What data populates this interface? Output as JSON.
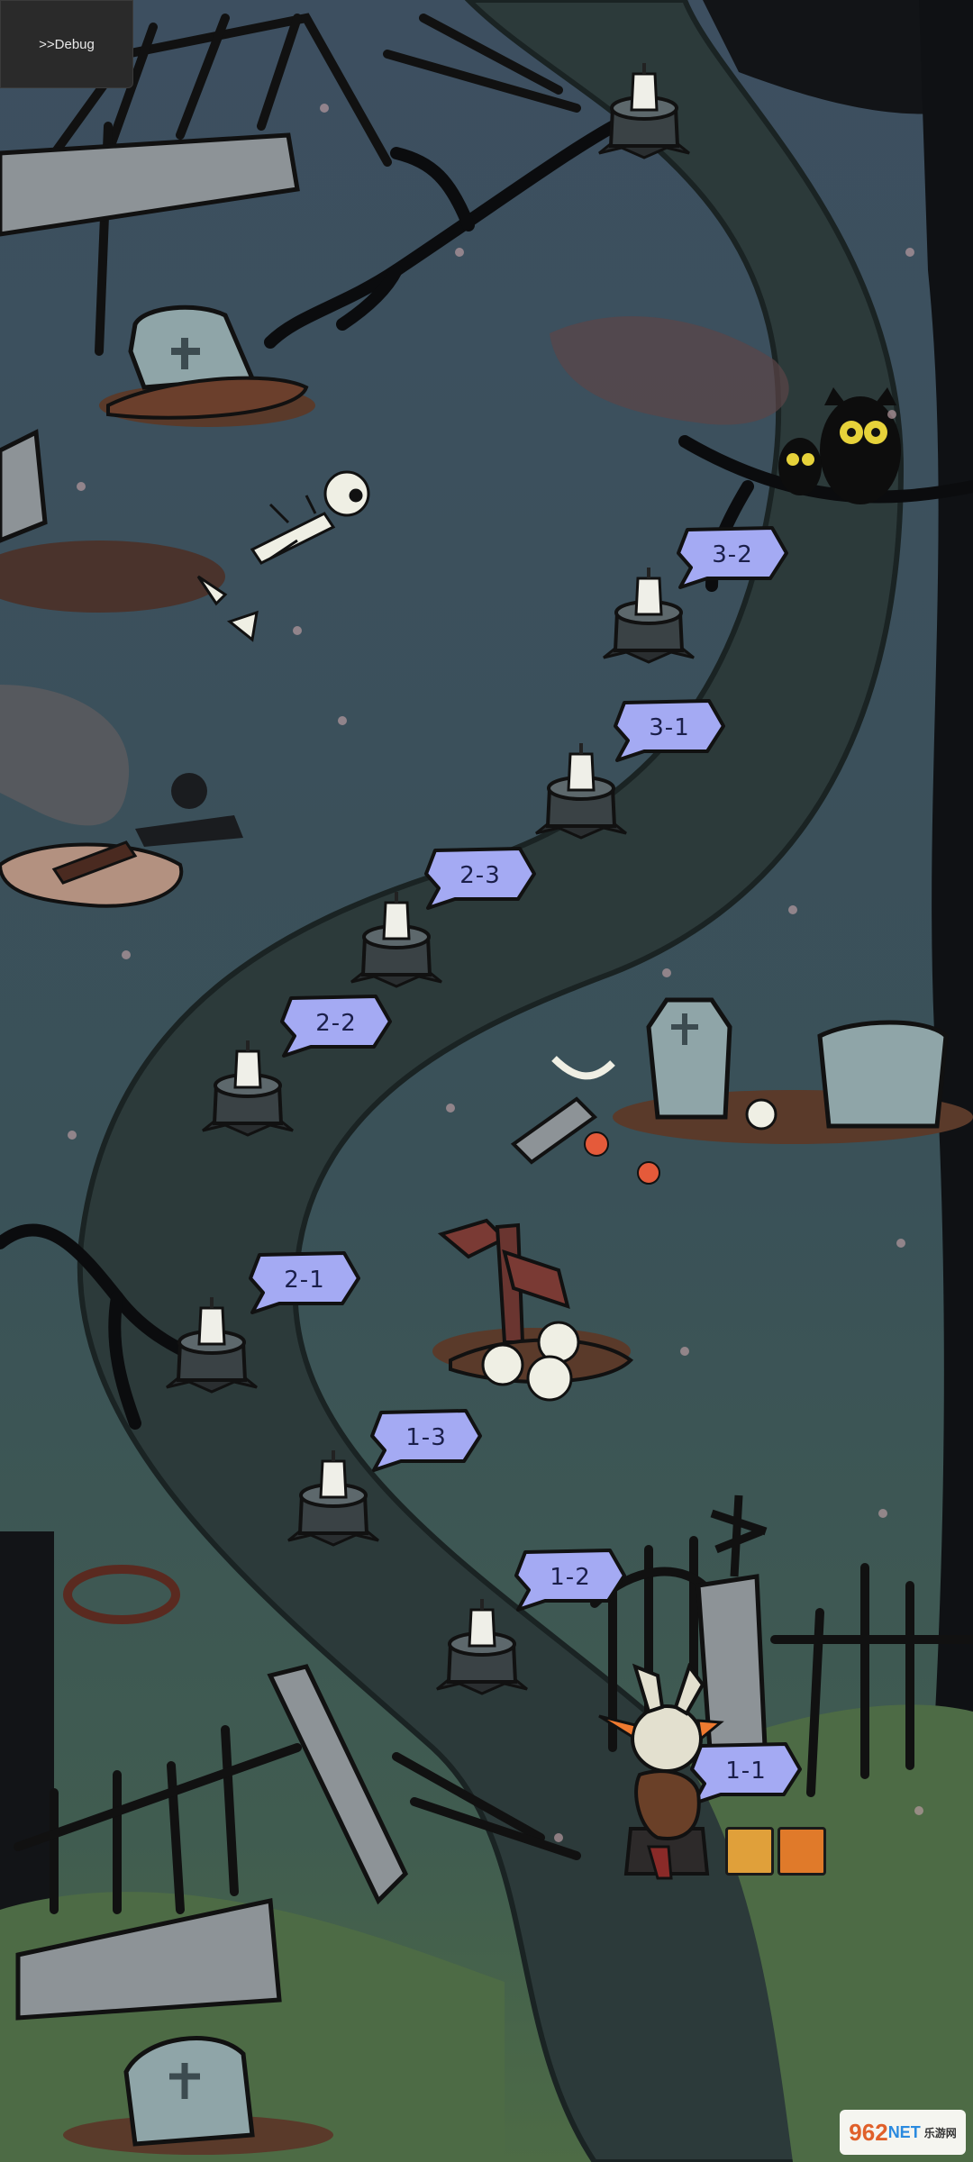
{
  "debug": {
    "label": ">>Debug"
  },
  "levels": [
    {
      "id": "1-1"
    },
    {
      "id": "1-2"
    },
    {
      "id": "1-3"
    },
    {
      "id": "2-1"
    },
    {
      "id": "2-2"
    },
    {
      "id": "2-3"
    },
    {
      "id": "3-1"
    },
    {
      "id": "3-2"
    }
  ],
  "colors": {
    "level_badge": "#a4aaf3",
    "path": "#2c3a3a",
    "grass_top": "#3e5563",
    "grass_bottom": "#4f6e48"
  },
  "watermark": {
    "brand": "962",
    "suffix": "NET",
    "sub": "乐游网"
  }
}
